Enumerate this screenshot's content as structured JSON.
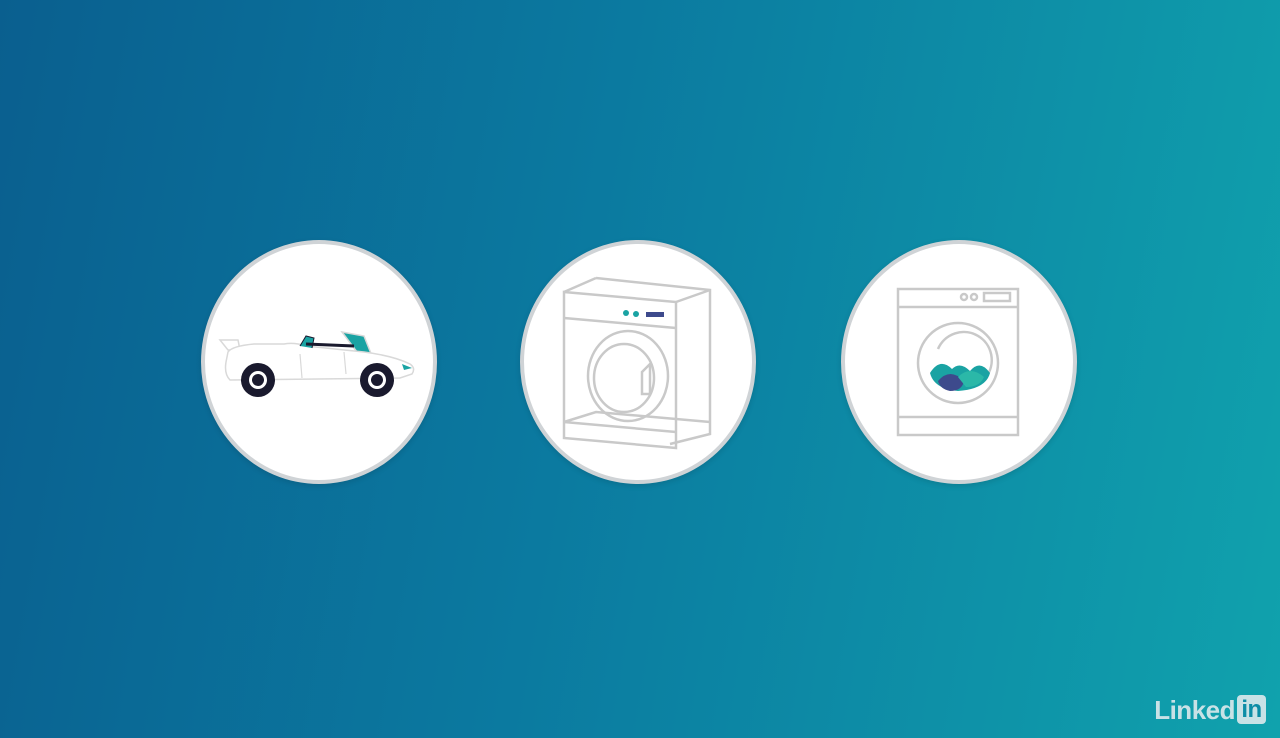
{
  "icons": [
    {
      "name": "car-icon",
      "description_color": "#1aa3a3"
    },
    {
      "name": "dryer-icon"
    },
    {
      "name": "washing-machine-icon"
    }
  ],
  "colors": {
    "background_start": "#0a5f8f",
    "background_end": "#10a2ad",
    "circle_fill": "#ffffff",
    "circle_border": "#cfd3d6",
    "accent_teal": "#1aa3a3",
    "accent_indigo": "#3d4a8c",
    "line_gray": "#c9c9c9"
  },
  "watermark": {
    "word": "Linked",
    "box": "in"
  }
}
